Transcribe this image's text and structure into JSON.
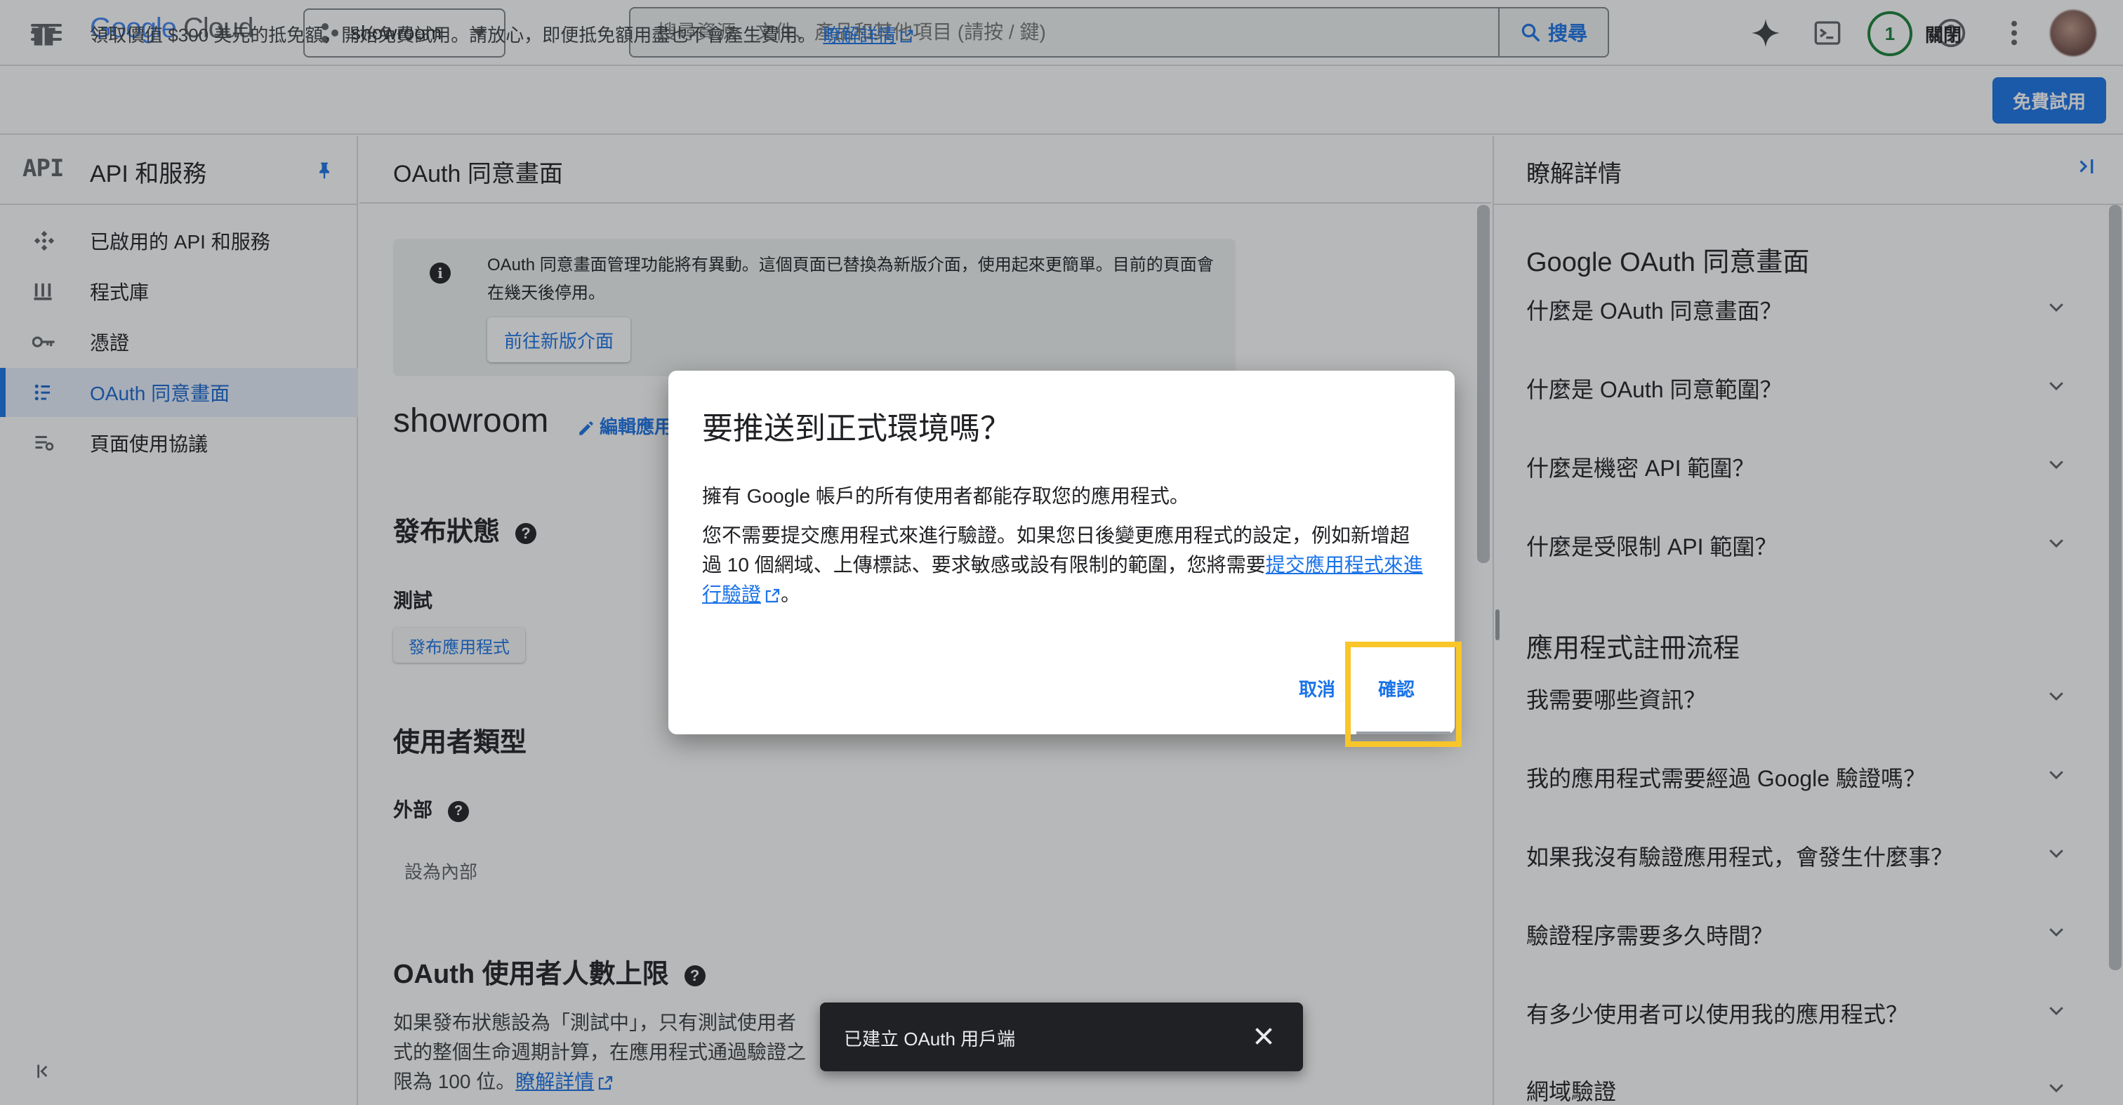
{
  "topbar": {
    "logo_google": "Google",
    "logo_cloud": "Cloud",
    "project": "showroom",
    "search_placeholder": "搜尋資源、文件、產品和其他項目 (請按 / 鍵)",
    "search_button": "搜尋",
    "notification_count": "1"
  },
  "promo": {
    "text": "領取價值 $300 美元的抵免額，開始免費試用。請放心，即便抵免額用盡也不會產生費用。",
    "link": "瞭解詳情",
    "close": "關閉",
    "trial_button": "免費試用"
  },
  "nav": {
    "logo": "API",
    "title": "API 和服務",
    "items": [
      {
        "label": "已啟用的 API 和服務",
        "icon": "api-hub-icon"
      },
      {
        "label": "程式庫",
        "icon": "library-icon"
      },
      {
        "label": "憑證",
        "icon": "key-icon"
      },
      {
        "label": "OAuth 同意畫面",
        "icon": "oauth-icon",
        "active": true
      },
      {
        "label": "頁面使用協議",
        "icon": "page-agreement-icon"
      }
    ]
  },
  "main": {
    "title": "OAuth 同意畫面",
    "notice_text": "OAuth 同意畫面管理功能將有異動。這個頁面已替換為新版介面，使用起來更簡單。目前的頁面會在幾天後停用。",
    "notice_button": "前往新版介面",
    "app_name": "showroom",
    "edit_app": "編輯應用",
    "publish_status_title": "發布狀態",
    "publish_status_value": "測試",
    "publish_button": "發布應用程式",
    "user_type_title": "使用者類型",
    "user_type_value": "外部",
    "set_internal": "設為內部",
    "user_limit_title": "OAuth 使用者人數上限",
    "user_limit_text_1": "如果發布狀態設為「測試中」，只有測試使用者",
    "user_limit_text_2": "式的整個生命週期計算，在應用程式通過驗證之",
    "user_limit_text_3": "限為 100 位。",
    "user_limit_link": "瞭解詳情"
  },
  "right_panel": {
    "title": "瞭解詳情",
    "section1": "Google OAuth 同意畫面",
    "section1_items": [
      "什麼是 OAuth 同意畫面？",
      "什麼是 OAuth 同意範圍？",
      "什麼是機密 API 範圍？",
      "什麼是受限制 API 範圍？"
    ],
    "section2": "應用程式註冊流程",
    "section2_items": [
      "我需要哪些資訊？",
      "我的應用程式需要經過 Google 驗證嗎？",
      "如果我沒有驗證應用程式，會發生什麼事？",
      "驗證程序需要多久時間？",
      "有多少使用者可以使用我的應用程式？",
      "網域驗證"
    ]
  },
  "dialog": {
    "title": "要推送到正式環境嗎？",
    "body1": "擁有 Google 帳戶的所有使用者都能存取您的應用程式。",
    "body2": "您不需要提交應用程式來進行驗證。如果您日後變更應用程式的設定，例如新增超過 10 個網域、上傳標誌、要求敏感或設有限制的範圍，您將需要",
    "body2_link": "提交應用程式來進行驗證",
    "body2_end": "。",
    "cancel": "取消",
    "confirm": "確認"
  },
  "toast": {
    "text": "已建立 OAuth 用戶端"
  },
  "colors": {
    "accent": "#1a73e8",
    "highlight": "#f9c62a",
    "active_nav_bg": "#e8f0fe"
  }
}
